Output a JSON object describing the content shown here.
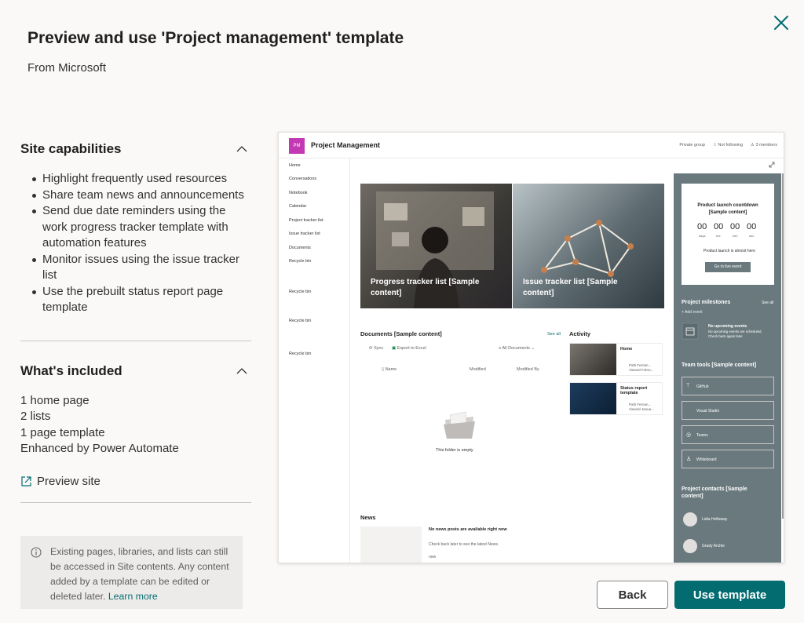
{
  "dialog": {
    "title": "Preview and use 'Project management' template",
    "subtitle": "From Microsoft"
  },
  "capabilities": {
    "heading": "Site capabilities",
    "items": [
      "Highlight frequently used resources",
      "Share team news and announcements",
      "Send due date reminders using the work progress tracker template with automation features",
      "Monitor issues using the issue tracker list",
      "Use the prebuilt status report page template"
    ]
  },
  "included": {
    "heading": "What's included",
    "items": [
      "1 home page",
      "2 lists",
      "1 page template",
      "Enhanced by Power Automate"
    ]
  },
  "preview_link": "Preview site",
  "info": {
    "text": "Existing pages, libraries, and lists can still be accessed in Site contents. Any content added by a template can be edited or deleted later.",
    "link": "Learn more"
  },
  "preview": {
    "logo": "PM",
    "site_title": "Project Management",
    "header_right": [
      "Private group",
      "Not following",
      "3 members"
    ],
    "nav": [
      "Home",
      "Conversations",
      "Notebook",
      "Calendar",
      "Project tracker list",
      "Issue tracker list",
      "Documents",
      "Recycle bin",
      "Recycle bin",
      "Recycle bin",
      "Recycle bin"
    ],
    "tile1": "Progress tracker list [Sample content]",
    "tile2": "Issue tracker list [Sample content]",
    "documents": {
      "heading": "Documents [Sample content]",
      "see_all": "See all",
      "sync": "Sync",
      "export": "Export to Excel",
      "all_docs": "All Documents",
      "col_name": "Name",
      "col_modified": "Modified",
      "col_modified_by": "Modified By",
      "empty": "This folder is empty"
    },
    "activity": {
      "heading": "Activity",
      "card1_title": "Home",
      "card1_user": "Patti Fernan...",
      "card1_sub": "Viewed Febru...",
      "card2_title": "Status report template",
      "card2_user": "Patti Fernan...",
      "card2_sub": "Viewed Janua..."
    },
    "news": {
      "heading": "News",
      "title": "No news posts are available right now",
      "sub": "Check back later to see the latest News.",
      "more": "now"
    },
    "countdown": {
      "title": "Product launch countdown [Sample content]",
      "values": [
        "00",
        "00",
        "00",
        "00"
      ],
      "units": [
        "days",
        "hrs",
        "min",
        "sec"
      ],
      "note": "Product launch is almost here",
      "button": "Go to live event"
    },
    "milestones": {
      "heading": "Project milestones",
      "see_all": "See all",
      "add": "Add event",
      "empty_title": "No upcoming events",
      "empty_sub": "No upcoming events are scheduled. Check back again later."
    },
    "tools": {
      "heading": "Team tools [Sample content]",
      "items": [
        "GitHub",
        "Visual Studio",
        "Teams",
        "Whiteboard"
      ]
    },
    "contacts": {
      "heading": "Project contacts [Sample content]",
      "people": [
        "Lidia Holloway",
        "Grady Archie"
      ]
    }
  },
  "actions": {
    "back": "Back",
    "use": "Use template"
  }
}
